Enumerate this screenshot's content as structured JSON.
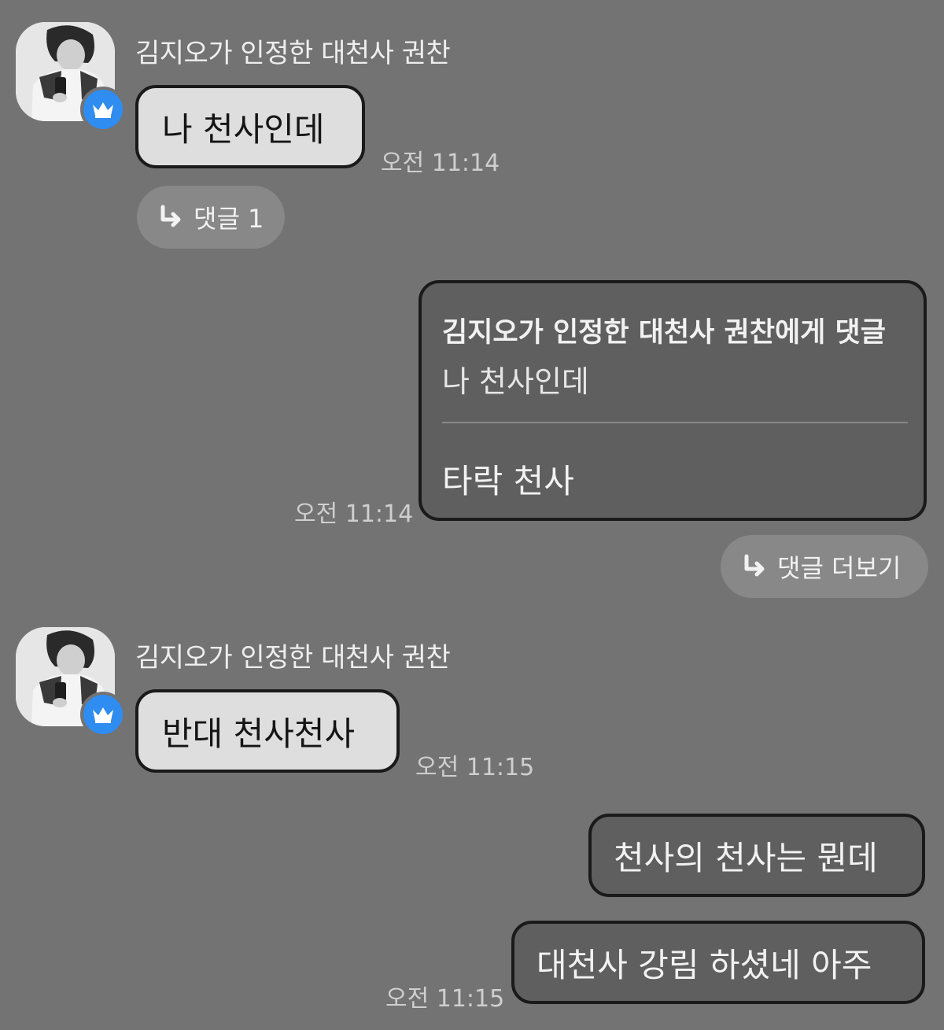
{
  "thread": {
    "sender_name": "김지오가 인정한 대천사 권찬",
    "messages": [
      {
        "text": "나 천사인데",
        "time": "오전 11:14",
        "reply_label": "댓글 1"
      },
      {
        "quote_header": "김지오가 인정한 대천사 권찬에게 댓글",
        "quote_original": "나 천사인데",
        "text": "타락 천사",
        "time": "오전 11:14",
        "reply_label": "댓글 더보기"
      },
      {
        "text": "반대 천사천사",
        "time": "오전 11:15"
      },
      {
        "text": "천사의 천사는 뭔데"
      },
      {
        "text": "대천사 강림 하셨네 아주",
        "time": "오전 11:15"
      }
    ]
  },
  "icons": {
    "badge": "crown-icon",
    "reply": "reply-arrow-icon"
  },
  "colors": {
    "background": "#737373",
    "badge": "#2f8cf0",
    "incoming_bubble": "#dedede",
    "outgoing_bubble": "#5f5f5f"
  }
}
